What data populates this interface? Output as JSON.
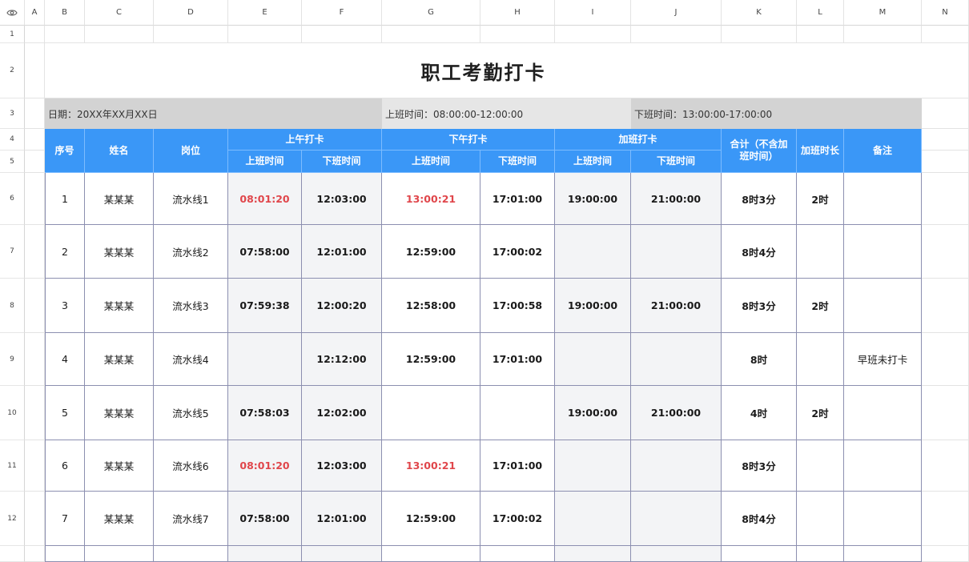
{
  "columns": [
    "A",
    "B",
    "C",
    "D",
    "E",
    "F",
    "G",
    "H",
    "I",
    "J",
    "K",
    "L",
    "M",
    "N"
  ],
  "rows": [
    "1",
    "2",
    "3",
    "4",
    "5",
    "6",
    "7",
    "8",
    "9",
    "10",
    "11",
    "12"
  ],
  "title": "职工考勤打卡",
  "info": {
    "date": "日期：20XX年XX月XX日",
    "work_start": "上班时间：08:00:00-12:00:00",
    "work_end": "下班时间：13:00:00-17:00:00"
  },
  "headers": {
    "seq": "序号",
    "name": "姓名",
    "post": "岗位",
    "morning": "上午打卡",
    "afternoon": "下午打卡",
    "overtime": "加班打卡",
    "total": "合计（不含加班时间）",
    "ot_hours": "加班时长",
    "remark": "备注",
    "in": "上班时间",
    "out": "下班时间"
  },
  "records": [
    {
      "seq": "1",
      "name": "某某某",
      "post": "流水线1",
      "am_in": "08:01:20",
      "am_out": "12:03:00",
      "pm_in": "13:00:21",
      "pm_out": "17:01:00",
      "ot_in": "19:00:00",
      "ot_out": "21:00:00",
      "total": "8时3分",
      "ot": "2时",
      "remark": "",
      "am_in_late": true,
      "pm_in_late": true
    },
    {
      "seq": "2",
      "name": "某某某",
      "post": "流水线2",
      "am_in": "07:58:00",
      "am_out": "12:01:00",
      "pm_in": "12:59:00",
      "pm_out": "17:00:02",
      "ot_in": "",
      "ot_out": "",
      "total": "8时4分",
      "ot": "",
      "remark": "",
      "am_in_late": false,
      "pm_in_late": false
    },
    {
      "seq": "3",
      "name": "某某某",
      "post": "流水线3",
      "am_in": "07:59:38",
      "am_out": "12:00:20",
      "pm_in": "12:58:00",
      "pm_out": "17:00:58",
      "ot_in": "19:00:00",
      "ot_out": "21:00:00",
      "total": "8时3分",
      "ot": "2时",
      "remark": "",
      "am_in_late": false,
      "pm_in_late": false
    },
    {
      "seq": "4",
      "name": "某某某",
      "post": "流水线4",
      "am_in": "",
      "am_out": "12:12:00",
      "pm_in": "12:59:00",
      "pm_out": "17:01:00",
      "ot_in": "",
      "ot_out": "",
      "total": "8时",
      "ot": "",
      "remark": "早班未打卡",
      "am_in_late": false,
      "pm_in_late": false
    },
    {
      "seq": "5",
      "name": "某某某",
      "post": "流水线5",
      "am_in": "07:58:03",
      "am_out": "12:02:00",
      "pm_in": "",
      "pm_out": "",
      "ot_in": "19:00:00",
      "ot_out": "21:00:00",
      "total": "4时",
      "ot": "2时",
      "remark": "",
      "am_in_late": false,
      "pm_in_late": false
    },
    {
      "seq": "6",
      "name": "某某某",
      "post": "流水线6",
      "am_in": "08:01:20",
      "am_out": "12:03:00",
      "pm_in": "13:00:21",
      "pm_out": "17:01:00",
      "ot_in": "",
      "ot_out": "",
      "total": "8时3分",
      "ot": "",
      "remark": "",
      "am_in_late": true,
      "pm_in_late": true
    },
    {
      "seq": "7",
      "name": "某某某",
      "post": "流水线7",
      "am_in": "07:58:00",
      "am_out": "12:01:00",
      "pm_in": "12:59:00",
      "pm_out": "17:00:02",
      "ot_in": "",
      "ot_out": "",
      "total": "8时4分",
      "ot": "",
      "remark": "",
      "am_in_late": false,
      "pm_in_late": false
    }
  ],
  "colors": {
    "header_blue": "#3a97f7",
    "info_gray": "#d3d3d3",
    "late_red": "#e0464b"
  },
  "icons": {
    "corner": "eye-icon"
  }
}
